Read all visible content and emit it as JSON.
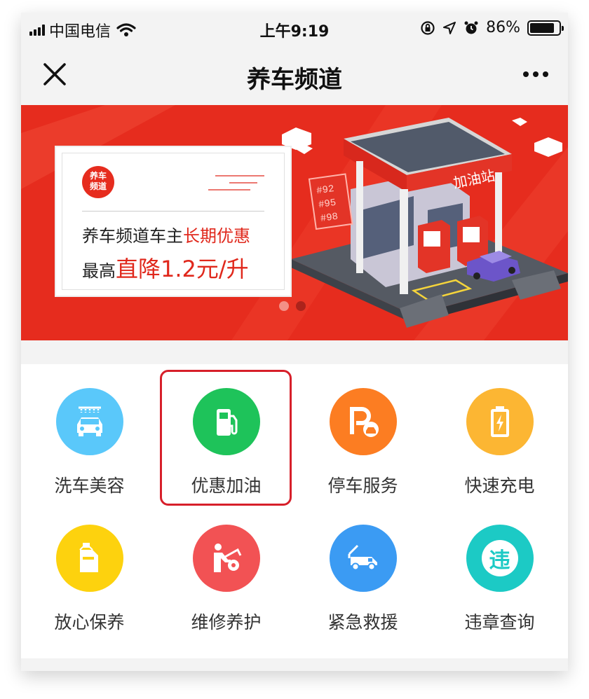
{
  "status_bar": {
    "carrier": "中国电信",
    "time": "上午9:19",
    "battery": "86%",
    "battery_level": 0.86
  },
  "nav": {
    "title": "养车频道",
    "close_icon": "close-icon",
    "more_icon": "more-icon"
  },
  "banner": {
    "logo_text": "养车频道",
    "line1_prefix": "养车频道车主",
    "line1_highlight": "长期优惠",
    "line2_prefix": "最高",
    "line2_highlight": "直降1.2元/升",
    "station_sign": "加油站",
    "fuel_grades": [
      "#92",
      "#95",
      "#98"
    ],
    "colors": {
      "background": "#e62c1e",
      "accent": "#e0281c"
    }
  },
  "services": [
    {
      "label": "洗车美容",
      "icon": "car-wash-icon",
      "color": "#5ac8fa"
    },
    {
      "label": "优惠加油",
      "icon": "fuel-pump-icon",
      "color": "#1ec35a",
      "highlighted": true
    },
    {
      "label": "停车服务",
      "icon": "parking-icon",
      "color": "#fc7d22"
    },
    {
      "label": "快速充电",
      "icon": "battery-charge-icon",
      "color": "#fcb633"
    },
    {
      "label": "放心保养",
      "icon": "oil-bottle-icon",
      "color": "#fdd20e"
    },
    {
      "label": "维修养护",
      "icon": "repair-icon",
      "color": "#f25254"
    },
    {
      "label": "紧急救援",
      "icon": "tow-truck-icon",
      "color": "#3b9bf3"
    },
    {
      "label": "违章查询",
      "icon": "violation-icon",
      "color": "#1ccac5",
      "glyph": "违"
    }
  ]
}
